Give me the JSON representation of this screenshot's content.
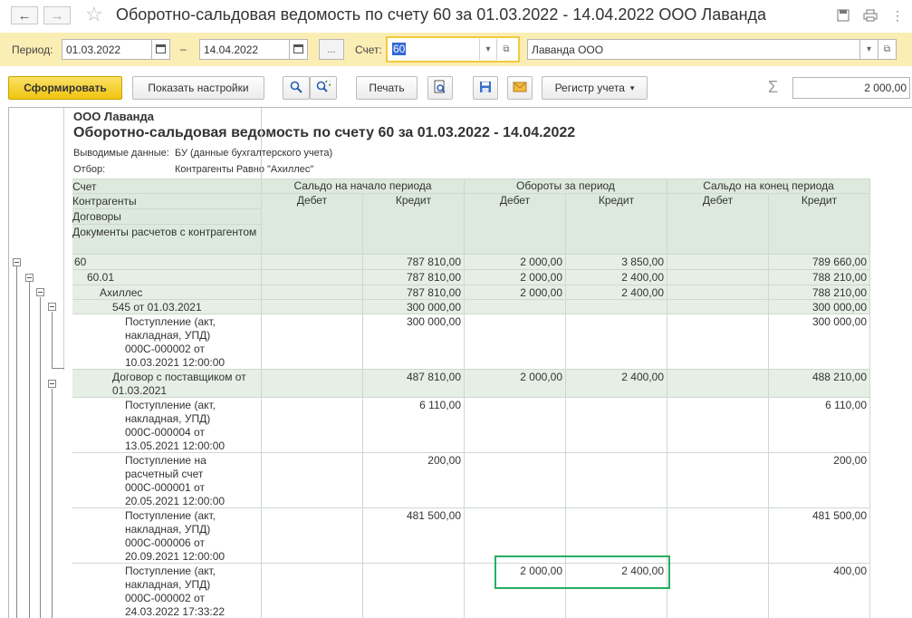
{
  "window": {
    "title": "Оборотно-сальдовая ведомость по счету 60 за 01.03.2022 - 14.04.2022 ООО Лаванда"
  },
  "params": {
    "period_label": "Период:",
    "date_from": "01.03.2022",
    "dash": "–",
    "date_to": "14.04.2022",
    "more_btn": "...",
    "account_label": "Счет:",
    "account_value": "60",
    "org_value": "Лаванда ООО"
  },
  "toolbar": {
    "generate": "Сформировать",
    "show_settings": "Показать настройки",
    "print": "Печать",
    "register": "Регистр учета",
    "sum_symbol": "Σ",
    "sum_value": "2 000,00"
  },
  "report": {
    "org": "ООО Лаванда",
    "title": "Оборотно-сальдовая ведомость по счету 60 за 01.03.2022 - 14.04.2022",
    "output_label": "Выводимые данные:",
    "output_value": "БУ (данные бухгалтерского учета)",
    "filter_label": "Отбор:",
    "filter_value": "Контрагенты Равно \"Ахиллес\"",
    "headers": {
      "account": "Счет",
      "contractors": "Контрагенты",
      "contracts": "Договоры",
      "documents": "Документы расчетов с контрагентом",
      "opening": "Сальдо на начало периода",
      "turnover": "Обороты за период",
      "closing": "Сальдо на конец периода",
      "debit": "Дебет",
      "credit": "Кредит"
    },
    "rows": [
      {
        "name": "60",
        "ob_cr": "787 810,00",
        "t_dr": "2 000,00",
        "t_cr": "3 850,00",
        "cb_cr": "789 660,00"
      },
      {
        "name": "60.01",
        "ob_cr": "787 810,00",
        "t_dr": "2 000,00",
        "t_cr": "2 400,00",
        "cb_cr": "788 210,00"
      },
      {
        "name": "Ахиллес",
        "ob_cr": "787 810,00",
        "t_dr": "2 000,00",
        "t_cr": "2 400,00",
        "cb_cr": "788 210,00"
      },
      {
        "name": "545 от 01.03.2021",
        "ob_cr": "300 000,00",
        "t_dr": "",
        "t_cr": "",
        "cb_cr": "300 000,00"
      },
      {
        "name": "Поступление (акт, накладная, УПД) 000С-000002 от 10.03.2021 12:00:00",
        "ob_cr": "300 000,00",
        "t_dr": "",
        "t_cr": "",
        "cb_cr": "300 000,00"
      },
      {
        "name": "Договор с поставщиком от 01.03.2021",
        "ob_cr": "487 810,00",
        "t_dr": "2 000,00",
        "t_cr": "2 400,00",
        "cb_cr": "488 210,00"
      },
      {
        "name": "Поступление (акт, накладная, УПД) 000С-000004 от 13.05.2021 12:00:00",
        "ob_cr": "6 110,00",
        "t_dr": "",
        "t_cr": "",
        "cb_cr": "6 110,00"
      },
      {
        "name": "Поступление на расчетный счет 000С-000001 от 20.05.2021 12:00:00",
        "ob_cr": "200,00",
        "t_dr": "",
        "t_cr": "",
        "cb_cr": "200,00"
      },
      {
        "name": "Поступление (акт, накладная, УПД) 000С-000006 от 20.09.2021 12:00:00",
        "ob_cr": "481 500,00",
        "t_dr": "",
        "t_cr": "",
        "cb_cr": "481 500,00"
      },
      {
        "name": "Поступление (акт, накладная, УПД) 000С-000002 от 24.03.2022 17:33:22",
        "ob_cr": "",
        "t_dr": "2 000,00",
        "t_cr": "2 400,00",
        "cb_cr": "400,00"
      }
    ]
  },
  "colors": {
    "param_bar": "#fbeeb4",
    "header_green": "#dde9dd",
    "row_green": "#e6efe6",
    "highlight_border": "#27ae60",
    "accent_yellow": "#f1c40f"
  }
}
